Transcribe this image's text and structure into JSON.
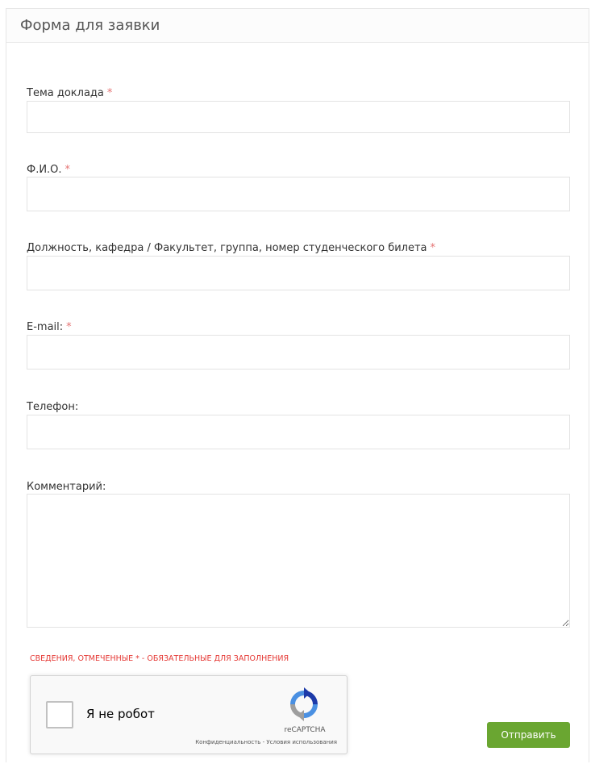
{
  "form": {
    "title": "Форма для заявки",
    "required_mark": "*",
    "fields": [
      {
        "label": "Тема доклада",
        "value": "",
        "placeholder": ""
      },
      {
        "label": "Ф.И.О.",
        "value": "",
        "placeholder": ""
      },
      {
        "label": "Должность, кафедра / Факультет, группа, номер студенческого билета",
        "value": "",
        "placeholder": ""
      },
      {
        "label": "E-mail:",
        "value": "",
        "placeholder": ""
      },
      {
        "label": "Телефон:",
        "value": "",
        "placeholder": ""
      },
      {
        "label": "Комментарий:",
        "value": "",
        "placeholder": ""
      }
    ],
    "required_notice": "Сведения, отмеченные * - обязательные для заполнения",
    "submit_label": "Отправить"
  },
  "captcha": {
    "checkbox_label": "Я не робот",
    "brand": "reCAPTCHA",
    "privacy_link": "Конфиденциальность",
    "separator": " - ",
    "terms_link": "Условия использования"
  },
  "colors": {
    "required_red": "#e57373",
    "notice_red": "#e53935",
    "submit_green": "#6aa631"
  }
}
